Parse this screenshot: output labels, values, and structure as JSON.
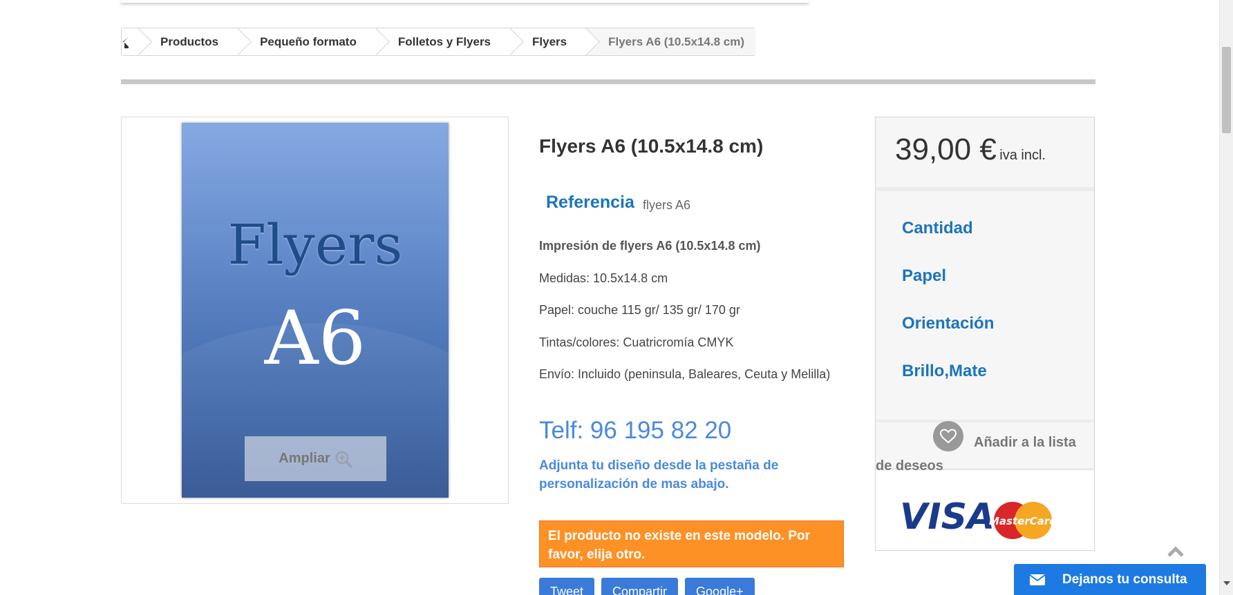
{
  "breadcrumb": {
    "home_icon": "home-icon",
    "items": [
      "Productos",
      "Pequeño formato",
      "Folletos y Flyers",
      "Flyers",
      "Flyers A6 (10.5x14.8 cm)"
    ]
  },
  "image": {
    "line1": "Flyers",
    "line2": "A6",
    "zoom_label": "Ampliar",
    "zoom_icon": "magnifier-plus-icon"
  },
  "product": {
    "title": "Flyers A6 (10.5x14.8 cm)",
    "ref_label": "Referencia",
    "ref_value": "flyers A6",
    "description": [
      "Impresión de flyers A6 (10.5x14.8 cm)",
      "Medidas: 10.5x14.8 cm",
      "Papel: couche 115 gr/ 135 gr/ 170 gr",
      "Tintas/colores: Cuatricromía CMYK",
      "Envío: Incluido (peninsula, Baleares, Ceuta y Melilla)"
    ],
    "phone": "Telf: 96 195 82 20",
    "attach_note": "Adjunta tu diseño desde la pestaña de personalización de mas abajo.",
    "warning": "El producto no existe en este modelo. Por favor, elija otro."
  },
  "social": [
    "Tweet",
    "Compartir",
    "Google+"
  ],
  "buybox": {
    "price": "39,00 €",
    "tax_note": "iva incl.",
    "attributes": [
      "Cantidad",
      "Papel",
      "Orientación",
      "Brillo,Mate"
    ],
    "wishlist": "Añadir a la lista de deseos",
    "wishlist_icon": "heart-icon",
    "payment_logos": [
      "VISA",
      "MasterCard"
    ]
  },
  "chat": {
    "label": "Dejanos tu consulta",
    "icon": "envelope-icon"
  },
  "colors": {
    "accent_blue": "#1c74bb",
    "link_blue": "#4a89dc",
    "warning_orange": "#fe9126",
    "chat_blue": "#1e7ae3"
  }
}
